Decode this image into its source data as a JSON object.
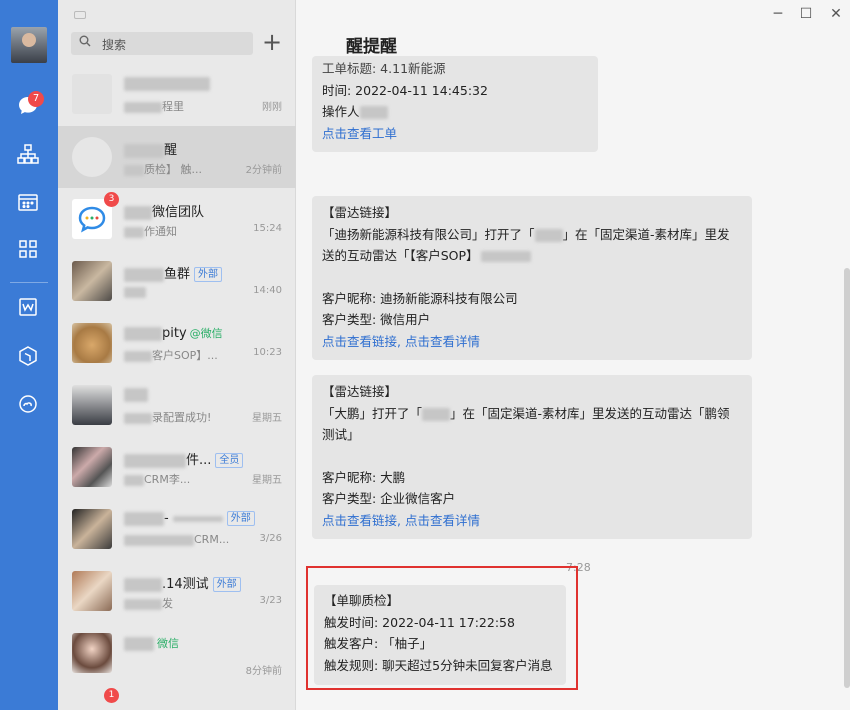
{
  "rail": {
    "unread_badge": "7"
  },
  "search": {
    "placeholder": "搜索"
  },
  "conversations": [
    {
      "name_suffix": "",
      "preview_suffix": "程里",
      "time": "刚刚"
    },
    {
      "name_suffix": "醒",
      "preview_suffix": "质检】 触...",
      "time": "2分钟前"
    },
    {
      "badge": "3",
      "name_suffix": "微信团队",
      "preview_suffix": "作通知",
      "time": "15:24"
    },
    {
      "name_suffix": "鱼群",
      "tag": "外部",
      "preview_suffix": "",
      "time": "14:40"
    },
    {
      "name_suffix": "pity",
      "wx": "@微信",
      "preview_suffix": "客户SOP】...",
      "time": "10:23"
    },
    {
      "name_suffix": "",
      "preview_suffix": "录配置成功!",
      "time": "星期五"
    },
    {
      "name_suffix": "件...",
      "tag": "全员",
      "preview_suffix": "CRM李...",
      "time": "星期五"
    },
    {
      "name_suffix": "-",
      "tag": "外部",
      "preview_suffix": "CRM...",
      "time": "3/26"
    },
    {
      "name_suffix": ".14测试",
      "tag": "外部",
      "preview_suffix": "发",
      "time": "3/23"
    },
    {
      "name_suffix": "",
      "wx": "微信",
      "preview_suffix": "",
      "time": "8分钟前"
    },
    {
      "badge": "1",
      "name_suffix": "",
      "preview_suffix": "",
      "time": ""
    }
  ],
  "chat": {
    "title": "醒提醒",
    "msg1": {
      "line1": "工单标题: 4.11新能源",
      "line2": "时间: 2022-04-11 14:45:32",
      "line3": "操作人",
      "link": "点击查看工单"
    },
    "msg2": {
      "line1": "【雷达链接】",
      "line2": "「迪扬新能源科技有限公司」打开了「",
      "line2b": "」在「固定渠道-素材库」里发",
      "line3": "送的互动雷达「【客户SOP】",
      "line4": "客户昵称: 迪扬新能源科技有限公司",
      "line5": "客户类型: 微信用户",
      "link1": "点击查看链接",
      "sep": ", ",
      "link2": "点击查看详情"
    },
    "msg3": {
      "line1": "【雷达链接】",
      "line2": "「大鹏」打开了「",
      "line2b": "」在「固定渠道-素材库」里发送的互动雷达「鹏领",
      "line3": "测试」",
      "line4": "客户昵称: 大鹏",
      "line5": "客户类型: 企业微信客户",
      "link1": "点击查看链接",
      "sep": ", ",
      "link2": "点击查看详情"
    },
    "time_divider": "7:28",
    "msg4": {
      "line1": "【单聊质检】",
      "line2": "触发时间: 2022-04-11 17:22:58",
      "line3": "触发客户: 「柚子」",
      "line4": "触发规则: 聊天超过5分钟未回复客户消息"
    }
  }
}
